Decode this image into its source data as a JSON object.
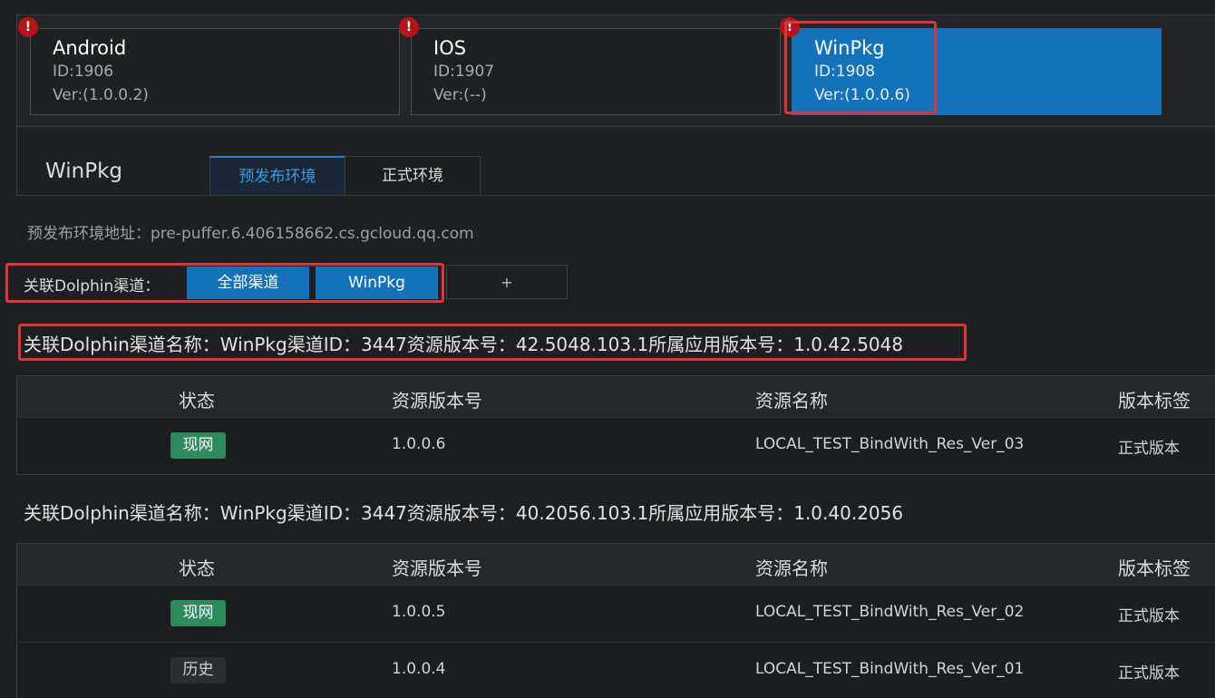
{
  "apps": [
    {
      "name": "Android",
      "id": "ID:1906",
      "ver": "Ver:(1.0.0.2)"
    },
    {
      "name": "IOS",
      "id": "ID:1907",
      "ver": "Ver:(--)"
    },
    {
      "name": "WinPkg",
      "id": "ID:1908",
      "ver": "Ver:(1.0.0.6)"
    }
  ],
  "alert_glyph": "!",
  "env": {
    "title": "WinPkg",
    "tabs": [
      "预发布环境",
      "正式环境"
    ],
    "address": "预发布环境地址：pre-puffer.6.406158662.cs.gcloud.qq.com"
  },
  "channel": {
    "label": "关联Dolphin渠道：",
    "buttons": [
      "全部渠道",
      "WinPkg"
    ],
    "add": "+"
  },
  "resources": [
    {
      "heading": "关联Dolphin渠道名称：WinPkg渠道ID：3447资源版本号：42.5048.103.1所属应用版本号：1.0.42.5048",
      "rows": [
        {
          "status": "现网",
          "version": "1.0.0.6",
          "name": "LOCAL_TEST_BindWith_Res_Ver_03",
          "tag": "正式版本"
        }
      ]
    },
    {
      "heading": "关联Dolphin渠道名称：WinPkg渠道ID：3447资源版本号：40.2056.103.1所属应用版本号：1.0.40.2056",
      "rows": [
        {
          "status": "现网",
          "version": "1.0.0.5",
          "name": "LOCAL_TEST_BindWith_Res_Ver_02",
          "tag": "正式版本"
        },
        {
          "status": "历史",
          "version": "1.0.0.4",
          "name": "LOCAL_TEST_BindWith_Res_Ver_01",
          "tag": "正式版本"
        }
      ]
    }
  ],
  "table_headers": {
    "status": "状态",
    "version": "资源版本号",
    "name": "资源名称",
    "tag": "版本标签"
  },
  "colors": {
    "accent": "#1472ba",
    "live_badge": "#2e8a5f",
    "highlight": "#e0343b",
    "alert": "#b4141a"
  }
}
